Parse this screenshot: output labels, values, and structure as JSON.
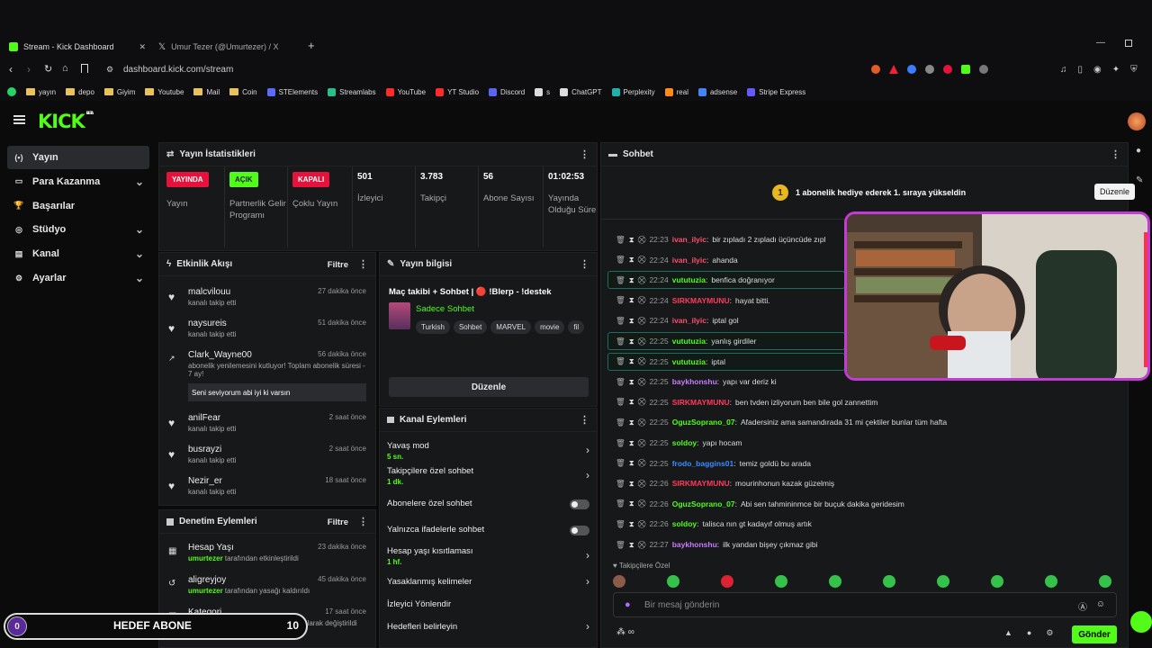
{
  "browser": {
    "tabs": [
      {
        "label": "Stream - Kick Dashboard",
        "active": true
      },
      {
        "label": "Umur Tezer (@Umurtezer) / X",
        "active": false
      }
    ],
    "url": "dashboard.kick.com/stream",
    "bookmarks": [
      "yayın",
      "depo",
      "Giyim",
      "Youtube",
      "Mail",
      "Coin",
      "STElements",
      "Streamlabs",
      "YouTube",
      "YT Studio",
      "Discord",
      "s",
      "ChatGPT",
      "Perplexity",
      "real",
      "adsense",
      "Stripe Express"
    ]
  },
  "app": {
    "logo": "KICK",
    "logo_beta": "BETA",
    "accent": "#53fc18",
    "sidebar": [
      {
        "label": "Yayın",
        "active": true,
        "has_chevron": false
      },
      {
        "label": "Para Kazanma",
        "active": false,
        "has_chevron": true
      },
      {
        "label": "Başarılar",
        "active": false,
        "has_chevron": false
      },
      {
        "label": "Stüdyo",
        "active": false,
        "has_chevron": true
      },
      {
        "label": "Kanal",
        "active": false,
        "has_chevron": true
      },
      {
        "label": "Ayarlar",
        "active": false,
        "has_chevron": true
      }
    ]
  },
  "stats": {
    "title": "Yayın İstatistikleri",
    "items": [
      {
        "badge": "YAYINDA",
        "badge_color": "#e5133b",
        "label": "Yayın"
      },
      {
        "badge": "AÇIK",
        "badge_color": "#53fc18",
        "label": "Partnerlik Gelir Programı"
      },
      {
        "badge": "KAPALI",
        "badge_color": "#e5133b",
        "label": "Çoklu Yayın"
      },
      {
        "value": "501",
        "label": "İzleyici"
      },
      {
        "value": "3.783",
        "label": "Takipçi"
      },
      {
        "value": "56",
        "label": "Abone Sayısı"
      },
      {
        "value": "01:02:53",
        "label": "Yayında Olduğu Süre"
      }
    ]
  },
  "activity": {
    "title": "Etkinlik Akışı",
    "filter": "Filtre",
    "items": [
      {
        "name": "malcvilouu",
        "sub": "kanalı takip etti",
        "time": "27 dakika önce"
      },
      {
        "name": "naysureis",
        "sub": "kanalı takip etti",
        "time": "51 dakika önce"
      },
      {
        "name": "Clark_Wayne00",
        "sub": "abonelik yenilemesini kutluyor! Toplam abonelik süresi - 7 ay!",
        "time": "56 dakika önce",
        "message": "Seni seviyorum abi iyi ki varsın"
      },
      {
        "name": "anilFear",
        "sub": "kanalı takip etti",
        "time": "2 saat önce"
      },
      {
        "name": "busrayzi",
        "sub": "kanalı takip etti",
        "time": "2 saat önce"
      },
      {
        "name": "Nezir_er",
        "sub": "kanalı takip etti",
        "time": "18 saat önce"
      }
    ]
  },
  "moderation": {
    "title": "Denetim Eylemleri",
    "filter": "Filtre",
    "items": [
      {
        "name": "Hesap Yaşı",
        "actor": "umurtezer",
        "sub": "tarafından etkinleştirildi",
        "time": "23 dakika önce"
      },
      {
        "name": "aligreyjoy",
        "actor": "umurtezer",
        "sub": "tarafından yasağı kaldırıldı",
        "time": "45 dakika önce"
      },
      {
        "name": "Kategori",
        "actor": "umurtezer",
        "sub": "tarafından Just Chatting olarak değiştirildi",
        "time": "17 saat önce"
      }
    ]
  },
  "goal": {
    "left": "0",
    "label": "HEDEF ABONE",
    "right": "10"
  },
  "stream_info": {
    "title": "Yayın bilgisi",
    "stream_title": "Maç takibi + Sohbet | 🔴 !Blerp - !destek",
    "category": "Sadece Sohbet",
    "tags": [
      "Turkish",
      "Sohbet",
      "MARVEL",
      "movie",
      "fil"
    ],
    "edit_button": "Düzenle"
  },
  "channel_actions": {
    "title": "Kanal Eylemleri",
    "items": [
      {
        "label": "Yavaş mod",
        "sub": "5 sn.",
        "control": "arrow"
      },
      {
        "label": "Takipçilere özel sohbet",
        "sub": "1 dk.",
        "control": "arrow"
      },
      {
        "label": "Abonelere özel sohbet",
        "sub": "",
        "control": "toggle"
      },
      {
        "label": "Yalnızca ifadelerle sohbet",
        "sub": "",
        "control": "toggle"
      },
      {
        "label": "Hesap yaşı kısıtlaması",
        "sub": "1 hf.",
        "control": "arrow"
      },
      {
        "label": "Yasaklanmış kelimeler",
        "sub": "",
        "control": "arrow"
      },
      {
        "label": "İzleyici Yönlendir",
        "sub": "",
        "control": "none"
      },
      {
        "label": "Hedefleri belirleyin",
        "sub": "",
        "control": "arrow"
      }
    ]
  },
  "chat": {
    "title": "Sohbet",
    "pinned": "1 abonelik hediye ederek 1. sıraya yükseldin",
    "pinned_rank": "1",
    "edit_tooltip": "Düzenle",
    "messages": [
      {
        "time": "22:23",
        "user": "ivan_ilyic",
        "color": "#ff4f6d",
        "text": "bir zıpladı 2 zıpladı üçüncüde zıpl"
      },
      {
        "time": "22:24",
        "user": "ivan_ilyic",
        "color": "#ff4f6d",
        "text": "ahanda"
      },
      {
        "time": "22:24",
        "user": "vututuzia",
        "color": "#53fc18",
        "text": "benfica doğranıyor",
        "highlight": true
      },
      {
        "time": "22:24",
        "user": "SIRKMAYMUNU",
        "color": "#ff3b5c",
        "text": "hayat bitti."
      },
      {
        "time": "22:24",
        "user": "ivan_ilyic",
        "color": "#ff4f6d",
        "text": "iptal gol"
      },
      {
        "time": "22:25",
        "user": "vututuzia",
        "color": "#53fc18",
        "text": "yanlış girdiler",
        "highlight": true
      },
      {
        "time": "22:25",
        "user": "vututuzia",
        "color": "#53fc18",
        "text": "iptal",
        "highlight": true
      },
      {
        "time": "22:25",
        "user": "baykhonshu",
        "color": "#c77dff",
        "text": "yapı var deriz ki"
      },
      {
        "time": "22:25",
        "user": "SIRKMAYMUNU",
        "color": "#ff3b5c",
        "text": "ben tvden izliyorum ben bile gol zannettim"
      },
      {
        "time": "22:25",
        "user": "OguzSoprano_07",
        "color": "#53fc18",
        "text": "Afadersiniz ama samandırada 31 mi çektiler bunlar tüm hafta"
      },
      {
        "time": "22:25",
        "user": "soldoy",
        "color": "#53fc18",
        "text": "yapı hocam"
      },
      {
        "time": "22:25",
        "user": "frodo_baggins01",
        "color": "#3d8bff",
        "text": "temiz goldü bu arada"
      },
      {
        "time": "22:26",
        "user": "SIRKMAYMUNU",
        "color": "#ff3b5c",
        "text": "mourinhonun kazak güzelmiş"
      },
      {
        "time": "22:26",
        "user": "OguzSoprano_07",
        "color": "#53fc18",
        "text": "Abi sen tahmininmce bir buçuk dakika geridesim"
      },
      {
        "time": "22:26",
        "user": "soldoy",
        "color": "#53fc18",
        "text": "talisca nın gt kadayıf olmuş artık"
      },
      {
        "time": "22:27",
        "user": "baykhonshu",
        "color": "#c77dff",
        "text": "ilk yandan bişey çıkmaz gibi"
      }
    ],
    "followers_only": "Takipçilere Özel",
    "placeholder": "Bir mesaj gönderin",
    "send": "Gönder"
  }
}
